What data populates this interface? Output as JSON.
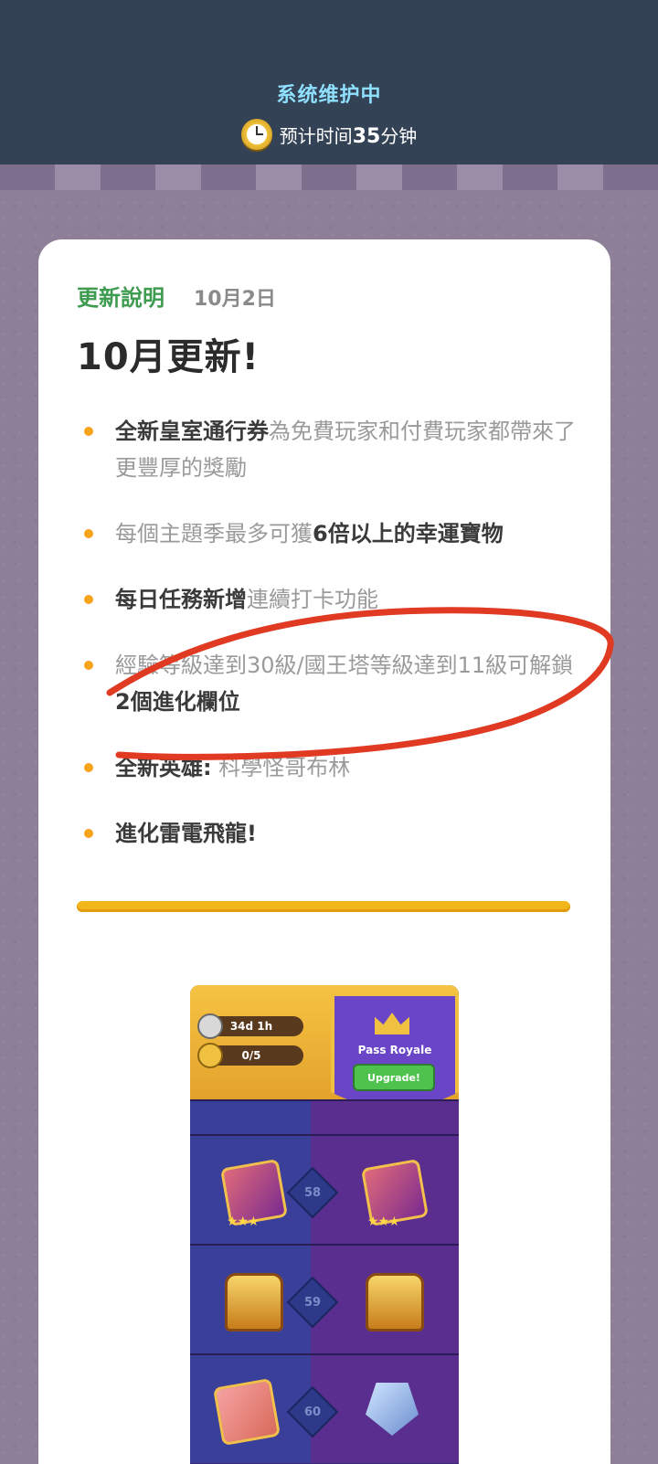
{
  "banner": {
    "title": "系统维护中",
    "time_prefix": "预计时间",
    "time_value": "35",
    "time_suffix": "分钟"
  },
  "card": {
    "label": "更新說明",
    "date": "10月2日",
    "title": "10月更新!",
    "bullets": [
      {
        "bold": "全新皇室通行券",
        "text": "為免費玩家和付費玩家都帶來了更豐厚的獎勵"
      },
      {
        "text": "每個主題季最多可獲",
        "bold": "6倍以上的幸運寶物"
      },
      {
        "bold": "每日任務新增",
        "text": "連續打卡功能"
      },
      {
        "text": "經驗等級達到30級/國王塔等級達到11級可解鎖",
        "bold": "2個進化欄位"
      },
      {
        "bold": "全新英雄:",
        "text": "科學怪哥布林"
      },
      {
        "bold": "進化雷電飛龍!"
      }
    ]
  },
  "pass_preview": {
    "timer": "34d 1h",
    "progress": "0/5",
    "banner_title": "Pass Royale",
    "upgrade_label": "Upgrade!",
    "levels": [
      "58",
      "59",
      "60"
    ]
  },
  "colors": {
    "accent_green": "#3e9b4f",
    "bullet_orange": "#f5a31a",
    "annotation_red": "#e03a22"
  }
}
